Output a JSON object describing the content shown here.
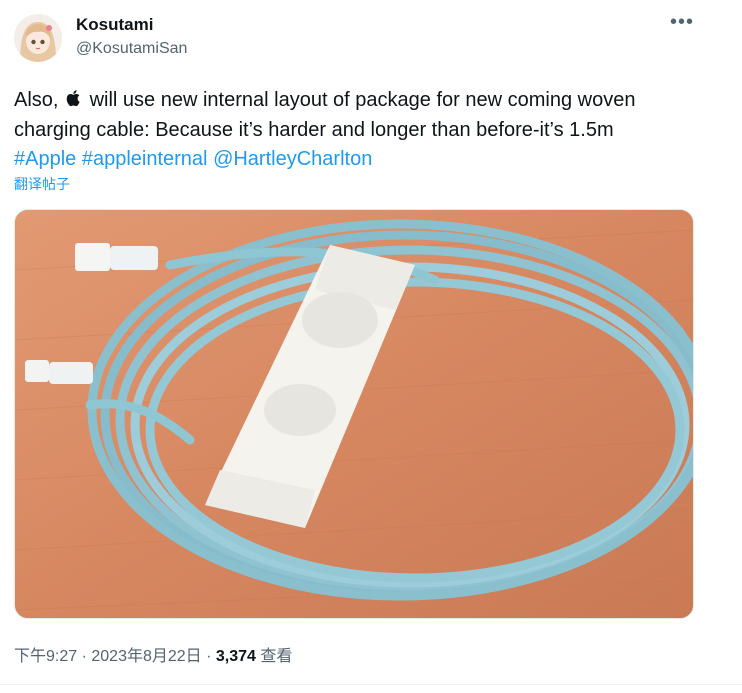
{
  "author": {
    "name": "Kosutami",
    "handle": "@KosutamiSan"
  },
  "icons": {
    "more": "more-horizontal-icon",
    "apple": "apple-logo-icon"
  },
  "tweet": {
    "line1_before_logo": "Also,",
    "line1_after_logo": "will use new internal layout of package for new coming woven",
    "line2": "charging cable: Because it’s harder and longer than before-it’s 1.5m",
    "hashtag1": "#Apple",
    "hashtag2": "#appleinternal",
    "mention": "@HartleyCharlton",
    "translate_label": "翻译帖子"
  },
  "meta": {
    "time": "下午9:27",
    "sep1": " · ",
    "date": "2023年8月22日",
    "sep2": " · ",
    "views_count": "3,374",
    "views_label": "查看"
  },
  "colors": {
    "link": "#1d9bf0",
    "secondary_text": "#536471",
    "primary_text": "#0f1419",
    "cable": "#8fc6d3",
    "table": "#d98a64"
  }
}
